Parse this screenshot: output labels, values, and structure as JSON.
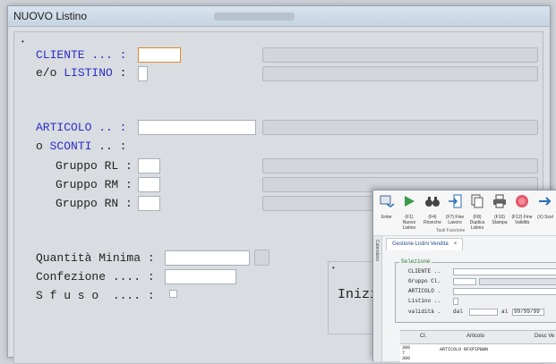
{
  "window": {
    "title": "NUOVO Listino"
  },
  "form": {
    "cliente_label": "CLIENTE ... :",
    "eo_prefix": "e/o ",
    "listino_label": "LISTINO",
    "listino_suffix": " :",
    "articolo_label": "ARTICOLO .. :",
    "o_prefix": "o ",
    "sconti_label": "SCONTI",
    "sconti_suffix": " .. :",
    "gruppo_rl": "Gruppo RL :",
    "gruppo_rm": "Gruppo RM :",
    "gruppo_rn": "Gruppo RN :",
    "quantita_minima": "Quantità Minima :",
    "confezione": "Confezione .... :",
    "sfuso": "S f u s o  .... :",
    "inizio_label": "Inizio"
  },
  "overlay": {
    "toolbar_buttons": [
      {
        "label": "Enter",
        "icon": "enter-icon"
      },
      {
        "label": "(F1) Nuovo Listino",
        "icon": "play-icon"
      },
      {
        "label": "(F4) Ricerche",
        "icon": "binoculars-icon"
      },
      {
        "label": "(F7) Fine Lavoro",
        "icon": "exit-icon"
      },
      {
        "label": "(F8) Duplica Listino",
        "icon": "duplicate-icon"
      },
      {
        "label": "(F10) Stampa",
        "icon": "printer-icon"
      },
      {
        "label": "(F12) Fine Validità",
        "icon": "stop-icon"
      },
      {
        "label": "(X) Scel",
        "icon": "arrow-right-icon"
      }
    ],
    "toolbar_group": "Tasti Funzione",
    "side_tab": "Calendario",
    "doc_tab": "Gestione Listini Vendita",
    "doc_tab_close": "×",
    "selezione_legend": "Selezione",
    "cliente": "CLIENTE ..",
    "gruppo": "Gruppo Cl.",
    "articolo": "ARTICOLO .",
    "listino": "Listino ..",
    "validita": "validità .",
    "dal": "dal",
    "al": "al",
    "al_value": "99/99/99",
    "grid_headers": [
      "Cl.",
      "Articolo",
      "Desc Ve"
    ],
    "grid_row": {
      "code_top": "300",
      "code_mid": "7",
      "code_bottom": "300",
      "articolo": "ARTICOLO RFXPIPBWN"
    }
  }
}
